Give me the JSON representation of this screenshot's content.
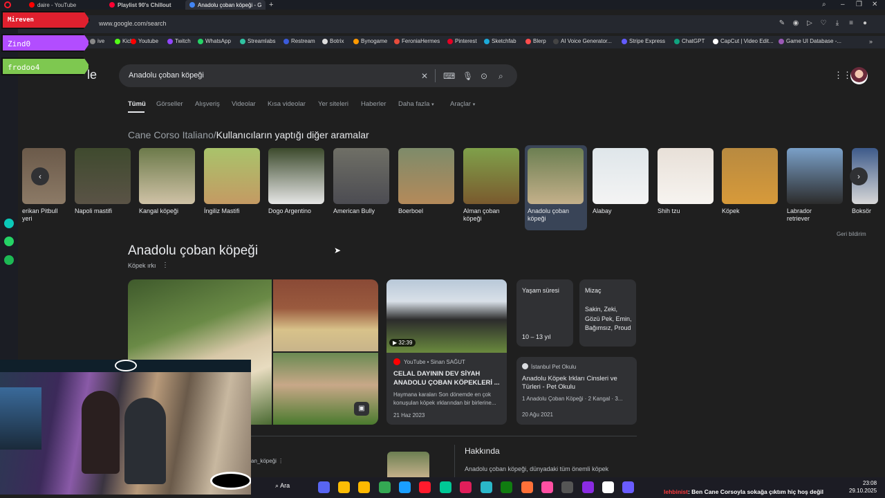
{
  "tabs": [
    {
      "title": "daire - YouTube",
      "color": "#ff0000"
    },
    {
      "title": "Playlist 90's Chillout",
      "color": "#ff0033"
    },
    {
      "title": "Anadolu çoban köpeği - G",
      "color": "#4285f4"
    }
  ],
  "browser": {
    "url": "www.google.com/search"
  },
  "bookmarks": [
    {
      "label": "ive",
      "color": "#888"
    },
    {
      "label": "Kick",
      "color": "#53fc18"
    },
    {
      "label": "Youtube",
      "color": "#ff0000"
    },
    {
      "label": "Twitch",
      "color": "#9146ff"
    },
    {
      "label": "WhatsApp",
      "color": "#25d366"
    },
    {
      "label": "Streamlabs",
      "color": "#31c3a2"
    },
    {
      "label": "Restream",
      "color": "#3b5bdb"
    },
    {
      "label": "Botrix",
      "color": "#dddddd"
    },
    {
      "label": "Bynogame",
      "color": "#ff9900"
    },
    {
      "label": "FeroniaHermes",
      "color": "#e74c3c"
    },
    {
      "label": "Pinterest",
      "color": "#e60023"
    },
    {
      "label": "Sketchfab",
      "color": "#1caad9"
    },
    {
      "label": "Blerp",
      "color": "#ff4d4d"
    },
    {
      "label": "AI Voice Generator...",
      "color": "#444"
    },
    {
      "label": "Stripe Express",
      "color": "#635bff"
    },
    {
      "label": "ChatGPT",
      "color": "#10a37f"
    },
    {
      "label": "CapCut | Video Edit...",
      "color": "#ffffff"
    },
    {
      "label": "Game UI Database -...",
      "color": "#9b59b6"
    }
  ],
  "overlay": {
    "tags": [
      {
        "name": "Mireven",
        "color": "#e0202e"
      },
      {
        "name": "Zind0",
        "color": "#b24dff"
      },
      {
        "name": "frodoo4",
        "color": "#7ec850"
      }
    ]
  },
  "search": {
    "query": "Anadolu çoban köpeği"
  },
  "nav_tabs": [
    "Tümü",
    "Görseller",
    "Alışveriş",
    "Videolar",
    "Kısa videolar",
    "Yer siteleri",
    "Haberler",
    "Daha fazla",
    "Araçlar"
  ],
  "related": {
    "prefix": "Cane Corso Italiano/",
    "heading": "Kullanıcıların yaptığı diğer aramalar",
    "items": [
      {
        "label": "erikan Pitbull\nyeri",
        "colors": [
          "#6b5a4a",
          "#8c7a66"
        ]
      },
      {
        "label": "Napoli mastifi",
        "colors": [
          "#3f4a2e",
          "#5a5346"
        ]
      },
      {
        "label": "Kangal köpeği",
        "colors": [
          "#6c7a4a",
          "#cfc2a6"
        ]
      },
      {
        "label": "İngiliz Mastifi",
        "colors": [
          "#a9c36b",
          "#c49a63"
        ]
      },
      {
        "label": "Dogo Argentino",
        "colors": [
          "#3c4a2c",
          "#e6e6e6"
        ]
      },
      {
        "label": "American Bully",
        "colors": [
          "#6f6f66",
          "#4c4c52"
        ]
      },
      {
        "label": "Boerboel",
        "colors": [
          "#7e8b6a",
          "#b48a5a"
        ]
      },
      {
        "label": "Alman çoban\nköpeği",
        "colors": [
          "#7fa04a",
          "#7a5a2e"
        ]
      },
      {
        "label": "Anadolu çoban\nköpeği",
        "colors": [
          "#6c7f52",
          "#c4b08a"
        ]
      },
      {
        "label": "Alabay",
        "colors": [
          "#dfe6ea",
          "#f4f4f4"
        ]
      },
      {
        "label": "Shih tzu",
        "colors": [
          "#e8e0d8",
          "#f7f4f0"
        ]
      },
      {
        "label": "Köpek",
        "colors": [
          "#b88a40",
          "#d79a3a"
        ]
      },
      {
        "label": "Labrador\nretriever",
        "colors": [
          "#7aa0c8",
          "#2c2c2c"
        ]
      },
      {
        "label": "Boksör",
        "colors": [
          "#3d5a8a",
          "#d8d8d8"
        ]
      }
    ],
    "feedback": "Geri bildirim"
  },
  "knowledge": {
    "title": "Anadolu çoban köpeği",
    "subtitle": "Köpek ırkı",
    "video": {
      "duration": "32:39",
      "source": "YouTube • Sinan SAĞUT",
      "title": "CELAL DAYININ DEV SİYAH ANADOLU ÇOBAN KÖPEKLERİ ...",
      "snippet": "Haymana karaları Son dönemde en çok konuşulan köpek ırklarından bir birlerine...",
      "date": "21 Haz 2023"
    },
    "lifespan": {
      "label": "Yaşam süresi",
      "value": "10 – 13 yıl"
    },
    "temperament": {
      "label": "Mizaç",
      "value": "Sakin, Zeki, Gözü Pek, Emin, Bağımsız, Proud"
    },
    "article": {
      "source": "İstanbul Pet Okulu",
      "title": "Anadolu Köpek Irkları Cinsleri ve Türleri - Pet Okulu",
      "snippet": "1 Anadolu Çoban Köpeği · 2 Kangal · 3...",
      "date": "20 Ağu 2021"
    },
    "about": {
      "heading": "Hakkında",
      "text": "Anadolu çoban köpeği, dünyadaki tüm önemli köpek"
    },
    "wiki_link": "an_köpeği"
  },
  "taskbar": {
    "search_label": "Ara",
    "ticker_user": "lehbinist",
    "ticker_text": ": Ben Cane Corsoyla sokağa çıktım hiç hoş değil",
    "time": "23:08",
    "date": "29.10.2025"
  }
}
